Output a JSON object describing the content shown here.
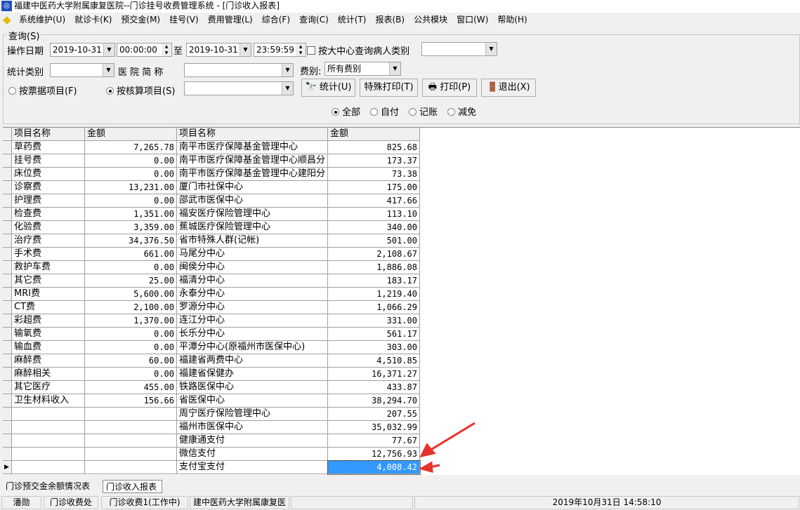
{
  "window": {
    "title": "福建中医药大学附属康复医院--门诊挂号收费管理系统 - [门诊收入报表]"
  },
  "menu": [
    "系统维护(U)",
    "就诊卡(K)",
    "预交金(M)",
    "挂号(V)",
    "费用管理(L)",
    "综合(F)",
    "查询(C)",
    "统计(T)",
    "报表(B)",
    "公共模块",
    "窗口(W)",
    "帮助(H)"
  ],
  "query": {
    "group_label": "查询(S)",
    "date_label": "操作日期",
    "start_date": "2019-10-31",
    "start_time": "00:00:00",
    "to_label": "至",
    "end_date": "2019-10-31",
    "end_time": "23:59:59",
    "center_checkbox_label": "按大中心查询病人类别",
    "center_checked": false,
    "patient_type": "",
    "stat_type_label": "统计类别",
    "stat_type": "",
    "hospital_label": "医 院 简 称",
    "hospital": "",
    "fee_label": "费别:",
    "fee_value": "所有费别",
    "radio_receipt": "按票据项目(F)",
    "radio_account": "按核算项目(S)",
    "account_item": "",
    "selected_item_mode": "按核算项目(S)",
    "btn_stat": "统计(U)",
    "btn_special_print": "特殊打印(T)",
    "btn_print": "打印(P)",
    "btn_exit": "退出(X)",
    "pay_filters": [
      "全部",
      "自付",
      "记账",
      "减免"
    ],
    "pay_selected": "全部"
  },
  "table": {
    "headers": [
      "项目名称",
      "金额",
      "项目名称",
      "金额"
    ],
    "left": [
      [
        "草药费",
        "7,265.78"
      ],
      [
        "挂号费",
        "0.00"
      ],
      [
        "床位费",
        "0.00"
      ],
      [
        "诊察费",
        "13,231.00"
      ],
      [
        "护理费",
        "0.00"
      ],
      [
        "检查费",
        "1,351.00"
      ],
      [
        "化验费",
        "3,359.00"
      ],
      [
        "治疗费",
        "34,376.50"
      ],
      [
        "手术费",
        "661.00"
      ],
      [
        "救护车费",
        "0.00"
      ],
      [
        "其它费",
        "25.00"
      ],
      [
        "MRI费",
        "5,600.00"
      ],
      [
        "CT费",
        "2,100.00"
      ],
      [
        "彩超费",
        "1,370.00"
      ],
      [
        "输氧费",
        "0.00"
      ],
      [
        "输血费",
        "0.00"
      ],
      [
        "麻醉费",
        "60.00"
      ],
      [
        "麻醉相关",
        "0.00"
      ],
      [
        "其它医疗",
        "455.00"
      ],
      [
        "卫生材料收入",
        "156.66"
      ]
    ],
    "right": [
      [
        "南平市医疗保障基金管理中心",
        "825.68"
      ],
      [
        "南平市医疗保障基金管理中心顺昌分",
        "173.37"
      ],
      [
        "南平市医疗保障基金管理中心建阳分",
        "73.38"
      ],
      [
        "厦门市社保中心",
        "175.00"
      ],
      [
        "邵武市医保中心",
        "417.66"
      ],
      [
        "福安医疗保险管理中心",
        "113.10"
      ],
      [
        "蕉城医疗保险管理中心",
        "340.00"
      ],
      [
        "省市特殊人群(记帐)",
        "501.00"
      ],
      [
        "马尾分中心",
        "2,108.67"
      ],
      [
        "闽侯分中心",
        "1,886.08"
      ],
      [
        "福清分中心",
        "183.17"
      ],
      [
        "永泰分中心",
        "1,219.40"
      ],
      [
        "罗源分中心",
        "1,066.29"
      ],
      [
        "连江分中心",
        "331.00"
      ],
      [
        "长乐分中心",
        "561.17"
      ],
      [
        "平潭分中心(原福州市医保中心)",
        "303.00"
      ],
      [
        "福建省两费中心",
        "4,510.85"
      ],
      [
        "福建省保健办",
        "16,371.27"
      ],
      [
        "铁路医保中心",
        "433.87"
      ],
      [
        "省医保中心",
        "38,294.70"
      ],
      [
        "周宁医疗保险管理中心",
        "207.55"
      ],
      [
        "福州市医保中心",
        "35,032.99"
      ],
      [
        "健康通支付",
        "77.67"
      ],
      [
        "微信支付",
        "12,756.93"
      ],
      [
        "支付宝支付",
        "4,008.42"
      ]
    ]
  },
  "tabs": [
    "门诊预交金余额情况表",
    "门诊收入报表"
  ],
  "active_tab": "门诊收入报表",
  "status": [
    "潘勋",
    "门诊收费处",
    "门诊收费1(工作中)",
    "建中医药大学附属康复医",
    "",
    "2019年10月31日 14:58:10"
  ],
  "colors": {
    "selection": "#3399ff",
    "arrow": "#e8322c"
  }
}
